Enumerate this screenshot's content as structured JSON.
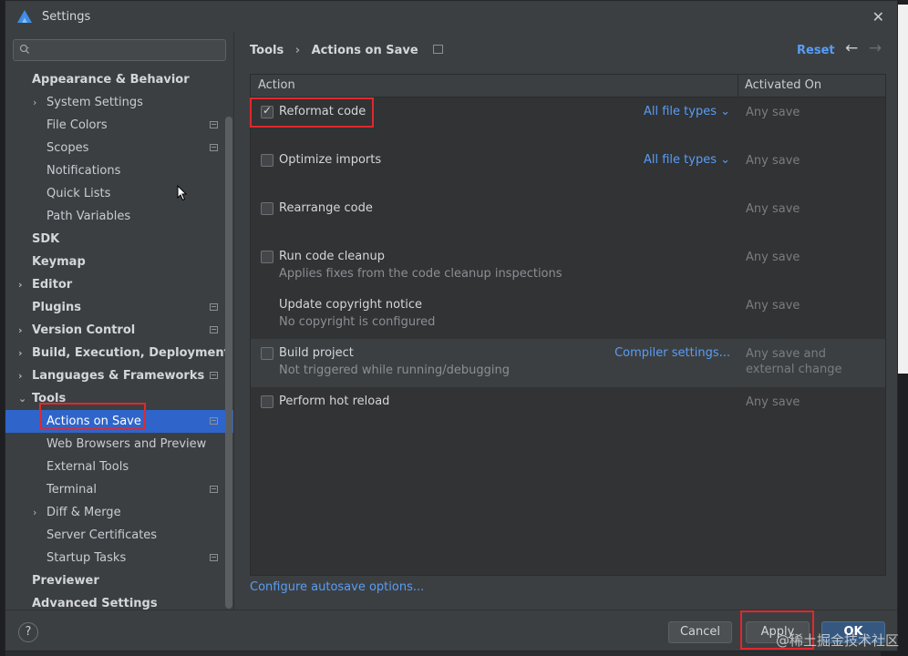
{
  "window": {
    "title": "Settings"
  },
  "search": {
    "placeholder": ""
  },
  "sidebar": {
    "items": [
      {
        "label": "Appearance & Behavior",
        "level": 0,
        "bold": true,
        "arrow": ""
      },
      {
        "label": "System Settings",
        "level": 1,
        "bold": false,
        "arrow": "›"
      },
      {
        "label": "File Colors",
        "level": 2,
        "bold": false,
        "arrow": "",
        "icon": true
      },
      {
        "label": "Scopes",
        "level": 2,
        "bold": false,
        "arrow": "",
        "icon": true
      },
      {
        "label": "Notifications",
        "level": 2,
        "bold": false,
        "arrow": ""
      },
      {
        "label": "Quick Lists",
        "level": 2,
        "bold": false,
        "arrow": ""
      },
      {
        "label": "Path Variables",
        "level": 2,
        "bold": false,
        "arrow": ""
      },
      {
        "label": "SDK",
        "level": 0,
        "bold": true,
        "arrow": ""
      },
      {
        "label": "Keymap",
        "level": 0,
        "bold": true,
        "arrow": ""
      },
      {
        "label": "Editor",
        "level": 0,
        "bold": true,
        "arrow": "›"
      },
      {
        "label": "Plugins",
        "level": 0,
        "bold": true,
        "arrow": "",
        "icon": true
      },
      {
        "label": "Version Control",
        "level": 0,
        "bold": true,
        "arrow": "›",
        "icon": true
      },
      {
        "label": "Build, Execution, Deployment",
        "level": 0,
        "bold": true,
        "arrow": "›"
      },
      {
        "label": "Languages & Frameworks",
        "level": 0,
        "bold": true,
        "arrow": "›",
        "icon": true
      },
      {
        "label": "Tools",
        "level": 0,
        "bold": true,
        "arrow": "⌄"
      },
      {
        "label": "Actions on Save",
        "level": 2,
        "bold": false,
        "arrow": "",
        "icon": true,
        "selected": true
      },
      {
        "label": "Web Browsers and Preview",
        "level": 2,
        "bold": false,
        "arrow": ""
      },
      {
        "label": "External Tools",
        "level": 2,
        "bold": false,
        "arrow": ""
      },
      {
        "label": "Terminal",
        "level": 2,
        "bold": false,
        "arrow": "",
        "icon": true
      },
      {
        "label": "Diff & Merge",
        "level": 1,
        "bold": false,
        "arrow": "›"
      },
      {
        "label": "Server Certificates",
        "level": 2,
        "bold": false,
        "arrow": ""
      },
      {
        "label": "Startup Tasks",
        "level": 2,
        "bold": false,
        "arrow": "",
        "icon": true
      },
      {
        "label": "Previewer",
        "level": 0,
        "bold": true,
        "arrow": ""
      },
      {
        "label": "Advanced Settings",
        "level": 0,
        "bold": true,
        "arrow": ""
      }
    ]
  },
  "breadcrumb": {
    "parent": "Tools",
    "separator": "›",
    "current": "Actions on Save"
  },
  "header": {
    "reset_label": "Reset",
    "back_icon": "←",
    "forward_icon": "→"
  },
  "table": {
    "col_action": "Action",
    "col_activated": "Activated On",
    "rows": [
      {
        "label": "Reformat code",
        "checked": true,
        "checkbox": true,
        "sub": "",
        "link": "All file types ⌄",
        "activated": "Any save"
      },
      {
        "label": "Optimize imports",
        "checked": false,
        "checkbox": true,
        "sub": "",
        "link": "All file types ⌄",
        "activated": "Any save"
      },
      {
        "label": "Rearrange code",
        "checked": false,
        "checkbox": true,
        "sub": "",
        "link": "",
        "activated": "Any save"
      },
      {
        "label": "Run code cleanup",
        "checked": false,
        "checkbox": true,
        "sub": "Applies fixes from the code cleanup inspections",
        "link": "",
        "activated": "Any save"
      },
      {
        "label": "Update copyright notice",
        "checked": false,
        "checkbox": false,
        "sub": "No copyright is configured",
        "link": "",
        "activated": "Any save"
      },
      {
        "label": "Build project",
        "checked": false,
        "checkbox": true,
        "sub": "Not triggered while running/debugging",
        "link": "Compiler settings...",
        "activated": "Any save and\nexternal change",
        "highlight": true
      },
      {
        "label": "Perform hot reload",
        "checked": false,
        "checkbox": true,
        "sub": "",
        "link": "",
        "activated": "Any save"
      }
    ]
  },
  "footer": {
    "autosave_link": "Configure autosave options...",
    "help_label": "?",
    "cancel_label": "Cancel",
    "apply_label": "Apply",
    "ok_label": "OK"
  },
  "watermark": "@稀土掘金技术社区",
  "colors": {
    "accent_link": "#589df6",
    "selection": "#2f65ca",
    "highlight_box": "#e0282e",
    "ok_button": "#365880"
  }
}
